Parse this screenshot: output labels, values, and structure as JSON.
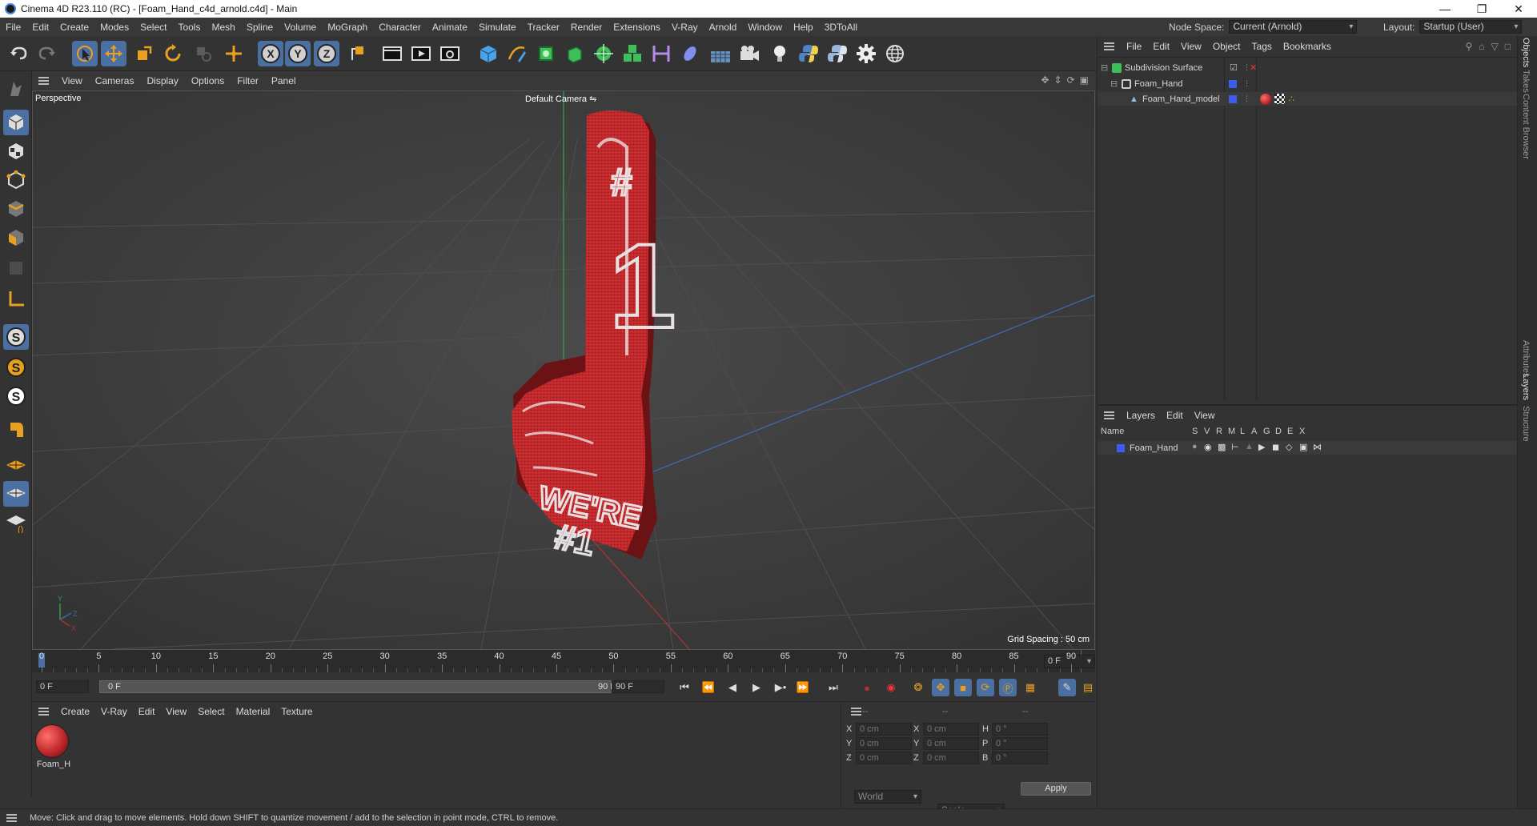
{
  "window": {
    "title": "Cinema 4D R23.110 (RC) - [Foam_Hand_c4d_arnold.c4d] - Main"
  },
  "menu": [
    "File",
    "Edit",
    "Create",
    "Modes",
    "Select",
    "Tools",
    "Mesh",
    "Spline",
    "Volume",
    "MoGraph",
    "Character",
    "Animate",
    "Simulate",
    "Tracker",
    "Render",
    "Extensions",
    "V-Ray",
    "Arnold",
    "Window",
    "Help",
    "3DToAll"
  ],
  "node_space": {
    "label": "Node Space:",
    "value": "Current (Arnold)"
  },
  "layout": {
    "label": "Layout:",
    "value": "Startup (User)"
  },
  "toolbar_axes": [
    "X",
    "Y",
    "Z"
  ],
  "viewport": {
    "menu": [
      "View",
      "Cameras",
      "Display",
      "Options",
      "Filter",
      "Panel"
    ],
    "projection": "Perspective",
    "camera": "Default Camera",
    "grid_spacing": "Grid Spacing : 50 cm",
    "axis_labels": {
      "y": "Y",
      "z": "Z",
      "x": "X"
    },
    "model_text": {
      "top": "#",
      "number": "1",
      "line1": "WE'RE",
      "line2": "#1"
    }
  },
  "timeline": {
    "ticks": [
      "0",
      "5",
      "10",
      "15",
      "20",
      "25",
      "30",
      "35",
      "40",
      "45",
      "50",
      "55",
      "60",
      "65",
      "70",
      "75",
      "80",
      "85",
      "90"
    ],
    "current_frame": "0 F",
    "start_field": "0 F",
    "range_start": "0 F",
    "range_end": "90 F",
    "end_field": "90 F"
  },
  "material_panel": {
    "menu": [
      "Create",
      "V-Ray",
      "Edit",
      "View",
      "Select",
      "Material",
      "Texture"
    ],
    "materials": [
      {
        "name": "Foam_H",
        "color": "#c0282c"
      }
    ]
  },
  "coords": {
    "header": [
      "--",
      "--",
      "--"
    ],
    "rows": [
      {
        "a": "X",
        "av": "0 cm",
        "b": "X",
        "bv": "0 cm",
        "c": "H",
        "cv": "0 °"
      },
      {
        "a": "Y",
        "av": "0 cm",
        "b": "Y",
        "bv": "0 cm",
        "c": "P",
        "cv": "0 °"
      },
      {
        "a": "Z",
        "av": "0 cm",
        "b": "Z",
        "bv": "0 cm",
        "c": "B",
        "cv": "0 °"
      }
    ],
    "mode1": "World",
    "mode2": "Scale",
    "apply": "Apply"
  },
  "objects_panel": {
    "menu": [
      "File",
      "Edit",
      "View",
      "Object",
      "Tags",
      "Bookmarks"
    ],
    "items": [
      {
        "name": "Subdivision Surface"
      },
      {
        "name": "Foam_Hand"
      },
      {
        "name": "Foam_Hand_model"
      }
    ]
  },
  "layers_panel": {
    "menu": [
      "Layers",
      "Edit",
      "View"
    ],
    "columns": [
      "Name",
      "S",
      "V",
      "R",
      "M",
      "L",
      "A",
      "G",
      "D",
      "E",
      "X"
    ],
    "layers": [
      {
        "name": "Foam_Hand",
        "color": "#3a5cf0"
      }
    ]
  },
  "side_tabs": [
    "Objects",
    "Takes",
    "Content Browser",
    "Attributes",
    "Layers",
    "Structure"
  ],
  "status": "Move: Click and drag to move elements. Hold down SHIFT to quantize movement / add to the selection in point mode, CTRL to remove.",
  "colors": {
    "accent": "#4b6fa1",
    "layer_blue": "#3a5cf0",
    "foam_red": "#c0282c"
  }
}
